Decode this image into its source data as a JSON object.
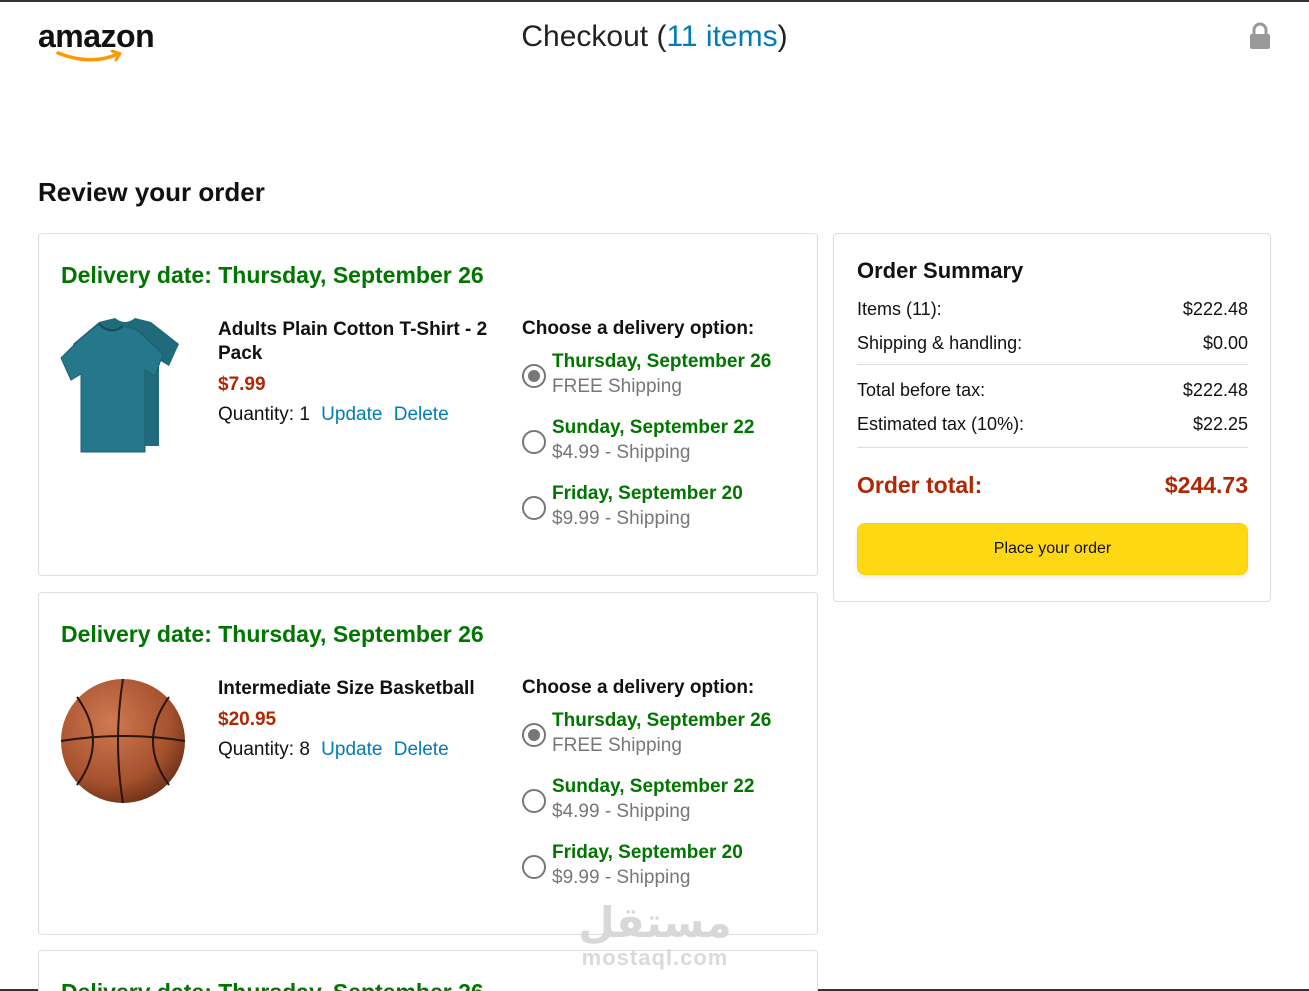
{
  "header": {
    "logo_text": "amazon",
    "checkout_prefix": "Checkout (",
    "items_link": "11 items",
    "checkout_suffix": ")"
  },
  "page_title": "Review your order",
  "orders": [
    {
      "delivery_date": "Delivery date: Thursday, September 26",
      "product_name": "Adults Plain Cotton T-Shirt - 2 Pack",
      "price": "$7.99",
      "quantity_label": "Quantity: 1",
      "update_label": "Update",
      "delete_label": "Delete",
      "options_title": "Choose a delivery option:",
      "options": [
        {
          "date": "Thursday, September 26",
          "shipping": "FREE Shipping",
          "selected": true
        },
        {
          "date": "Sunday, September 22",
          "shipping": "$4.99 - Shipping",
          "selected": false
        },
        {
          "date": "Friday, September 20",
          "shipping": "$9.99 - Shipping",
          "selected": false
        }
      ]
    },
    {
      "delivery_date": "Delivery date: Thursday, September 26",
      "product_name": "Intermediate Size Basketball",
      "price": "$20.95",
      "quantity_label": "Quantity: 8",
      "update_label": "Update",
      "delete_label": "Delete",
      "options_title": "Choose a delivery option:",
      "options": [
        {
          "date": "Thursday, September 26",
          "shipping": "FREE Shipping",
          "selected": true
        },
        {
          "date": "Sunday, September 22",
          "shipping": "$4.99 - Shipping",
          "selected": false
        },
        {
          "date": "Friday, September 20",
          "shipping": "$9.99 - Shipping",
          "selected": false
        }
      ]
    },
    {
      "delivery_date": "Delivery date: Thursday, September 26"
    }
  ],
  "summary": {
    "title": "Order Summary",
    "items_label": "Items (11):",
    "items_value": "$222.48",
    "shipping_label": "Shipping & handling:",
    "shipping_value": "$0.00",
    "before_tax_label": "Total before tax:",
    "before_tax_value": "$222.48",
    "tax_label": "Estimated tax (10%):",
    "tax_value": "$22.25",
    "total_label": "Order total:",
    "total_value": "$244.73",
    "place_order_label": "Place your order"
  },
  "watermark": {
    "arabic": "مستقل",
    "latin": "mostaql.com"
  },
  "colors": {
    "delivery_green": "#007600",
    "price_red": "#b12704",
    "link_blue": "#017cb5",
    "button_yellow": "#ffd814"
  },
  "icons": [
    "amazon-smile-logo",
    "lock-icon",
    "tshirt-image",
    "basketball-image"
  ]
}
